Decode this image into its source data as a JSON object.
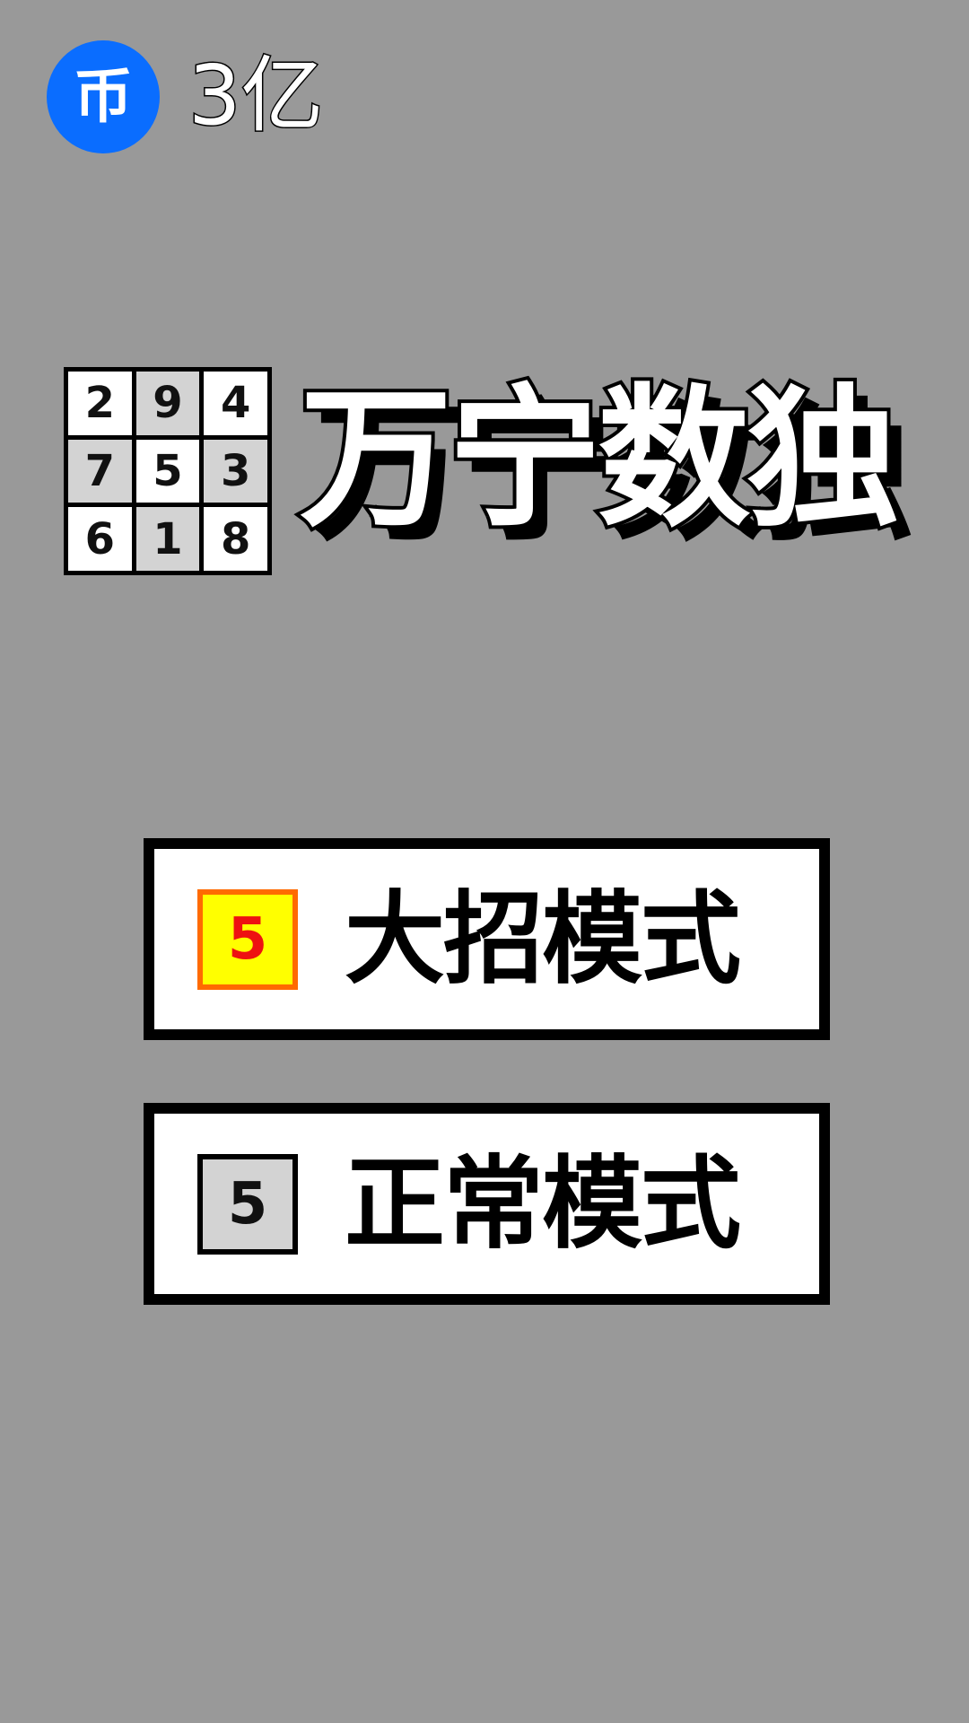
{
  "coins": {
    "icon_glyph": "币",
    "icon_name": "coin-icon",
    "amount": "3亿",
    "icon_color": "#0a6dff"
  },
  "logo": {
    "grid": [
      [
        "2",
        "9",
        "4"
      ],
      [
        "7",
        "5",
        "3"
      ],
      [
        "6",
        "1",
        "8"
      ]
    ]
  },
  "title": "万宁数独",
  "modes": {
    "special": {
      "badge": "5",
      "label": "大招模式",
      "badge_bg": "#ffff00",
      "badge_border": "#ff6a00",
      "badge_text_color": "#ee1111"
    },
    "normal": {
      "badge": "5",
      "label": "正常模式",
      "badge_bg": "#d3d3d3",
      "badge_border": "#000000",
      "badge_text_color": "#111111"
    }
  },
  "colors": {
    "background": "#999999"
  }
}
